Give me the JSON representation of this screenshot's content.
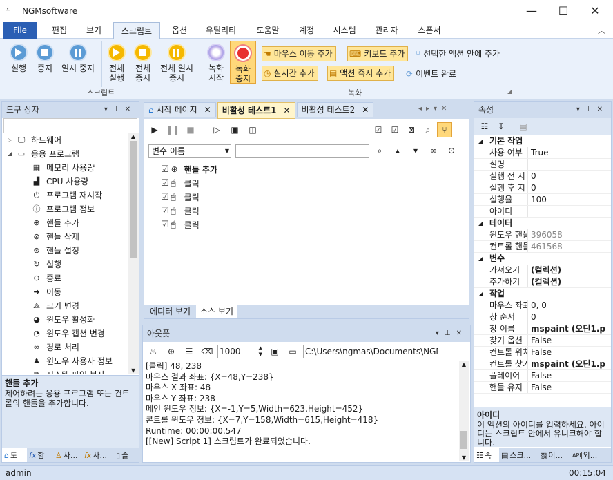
{
  "app": {
    "title": "NGMsoftware"
  },
  "menu": [
    "File",
    "편집",
    "보기",
    "스크립트",
    "옵션",
    "유틸리티",
    "도움말",
    "계정",
    "시스템",
    "관리자",
    "스폰서"
  ],
  "ribbon": {
    "script_group": "스크립트",
    "record_group": "녹화",
    "buttons": {
      "run": "실행",
      "stop": "중지",
      "pause": "일시 중지",
      "all_run": "전체 실행",
      "all_stop": "전체 중지",
      "all_pause": "전체 일시 중지",
      "rec_start": "녹화 시작",
      "rec_stop": "녹화 중지",
      "add_mouse_move": "마우스 이동 추가",
      "add_keyboard": "키보드 추가",
      "add_in_selected": "선택한 액션 안에 추가",
      "add_realtime": "실시간 추가",
      "add_action_now": "액션 즉시 추가",
      "event_done": "이벤트 완료"
    }
  },
  "toolbox": {
    "title": "도구 상자",
    "items": [
      {
        "label": "하드웨어",
        "level": 0,
        "icon": "computer-icon"
      },
      {
        "label": "응용 프로그램",
        "level": 0,
        "icon": "terminal-icon"
      },
      {
        "label": "메모리 사용량",
        "level": 1,
        "icon": "memory-icon"
      },
      {
        "label": "CPU 사용량",
        "level": 1,
        "icon": "chart-icon"
      },
      {
        "label": "프로그램 재시작",
        "level": 1,
        "icon": "power-icon"
      },
      {
        "label": "프로그램 정보",
        "level": 1,
        "icon": "info-icon"
      },
      {
        "label": "핸들 추가",
        "level": 1,
        "icon": "crosshair-icon"
      },
      {
        "label": "핸들 삭제",
        "level": 1,
        "icon": "crosshair-delete-icon"
      },
      {
        "label": "핸들 설정",
        "level": 1,
        "icon": "crosshair-settings-icon"
      },
      {
        "label": "실행",
        "level": 1,
        "icon": "run-icon"
      },
      {
        "label": "종료",
        "level": 1,
        "icon": "exit-icon"
      },
      {
        "label": "이동",
        "level": 1,
        "icon": "move-icon"
      },
      {
        "label": "크기 변경",
        "level": 1,
        "icon": "resize-icon"
      },
      {
        "label": "윈도우 활성화",
        "level": 1,
        "icon": "activate-icon"
      },
      {
        "label": "윈도우 캡션 변경",
        "level": 1,
        "icon": "caption-icon"
      },
      {
        "label": "경로 처리",
        "level": 1,
        "icon": "infinity-icon"
      },
      {
        "label": "윈도우 사용자 정보",
        "level": 1,
        "icon": "user-icon"
      },
      {
        "label": "시스템 파일 복사",
        "level": 1,
        "icon": "copy-icon"
      }
    ],
    "desc_title": "핸들 추가",
    "desc_text": "제어하려는 응용 프로그램 또는 컨트롤의 핸들을 추가합니다.",
    "bottom_tabs": [
      "도",
      "함",
      "사...",
      "사...",
      "즐"
    ]
  },
  "editor": {
    "tabs": [
      "시작 페이지",
      "비활성 테스트1",
      "비활성 테스트2"
    ],
    "var_select": "변수 이름",
    "search_value": "",
    "tree": [
      {
        "label": "핸들 추가",
        "bold": true,
        "level": 0
      },
      {
        "label": "클릭",
        "bold": false,
        "level": 0
      },
      {
        "label": "클릭",
        "bold": false,
        "level": 0
      },
      {
        "label": "클릭",
        "bold": false,
        "level": 0
      },
      {
        "label": "클릭",
        "bold": false,
        "level": 0
      }
    ],
    "view_tabs": [
      "에디터 보기",
      "소스 보기"
    ]
  },
  "output": {
    "title": "아웃풋",
    "interval": "1000",
    "path": "C:\\Users\\ngmas\\Documents\\NGM6\\",
    "lines": [
      "[클릭] 48, 238",
      "마우스 결과 좌표: {X=48,Y=238}",
      "마우스 X 좌표: 48",
      "마우스 Y 좌표: 238",
      "메인 윈도우 정보: {X=-1,Y=5,Width=623,Height=452}",
      "콘트롤 윈도우 정보: {X=7,Y=158,Width=615,Height=418}",
      "Runtime: 00:00:00.547",
      "[[New] Script 1] 스크립트가 완료되었습니다."
    ]
  },
  "properties": {
    "title": "속성",
    "categories": [
      {
        "name": "기본 작업",
        "rows": [
          [
            "사용 여부",
            "True"
          ],
          [
            "설명",
            ""
          ],
          [
            "실행 전 지",
            "0"
          ],
          [
            "실행 후 지",
            "0"
          ],
          [
            "실행율",
            "100"
          ],
          [
            "아이디",
            ""
          ]
        ]
      },
      {
        "name": "데이터",
        "rows": [
          [
            "윈도우 핸들",
            "396058"
          ],
          [
            "컨트롤 핸들",
            "461568"
          ]
        ]
      },
      {
        "name": "변수",
        "rows": [
          [
            "가져오기",
            "(컬렉션)"
          ],
          [
            "추가하기",
            "(컬렉션)"
          ]
        ]
      },
      {
        "name": "작업",
        "rows": [
          [
            "마우스 좌표",
            "0, 0"
          ],
          [
            "창 순서",
            "0"
          ],
          [
            "창 이름",
            "mspaint (오딘1.p"
          ],
          [
            "찾기 옵션",
            "False"
          ],
          [
            "컨트롤 위치",
            "False"
          ],
          [
            "컨트롤 찾기",
            "mspaint (오딘1.p"
          ],
          [
            "플레이어",
            "False"
          ],
          [
            "핸들 유지",
            "False"
          ]
        ]
      }
    ],
    "desc_title": "아이디",
    "desc_text": "이 액션의 아이디를 입력하세요. 아이디는 스크립트 안에서 유니크해야 합니다.",
    "bottom_tabs": [
      "속",
      "스크...",
      "이...",
      "외..."
    ]
  },
  "status": {
    "user": "admin",
    "time": "00:15:04"
  }
}
